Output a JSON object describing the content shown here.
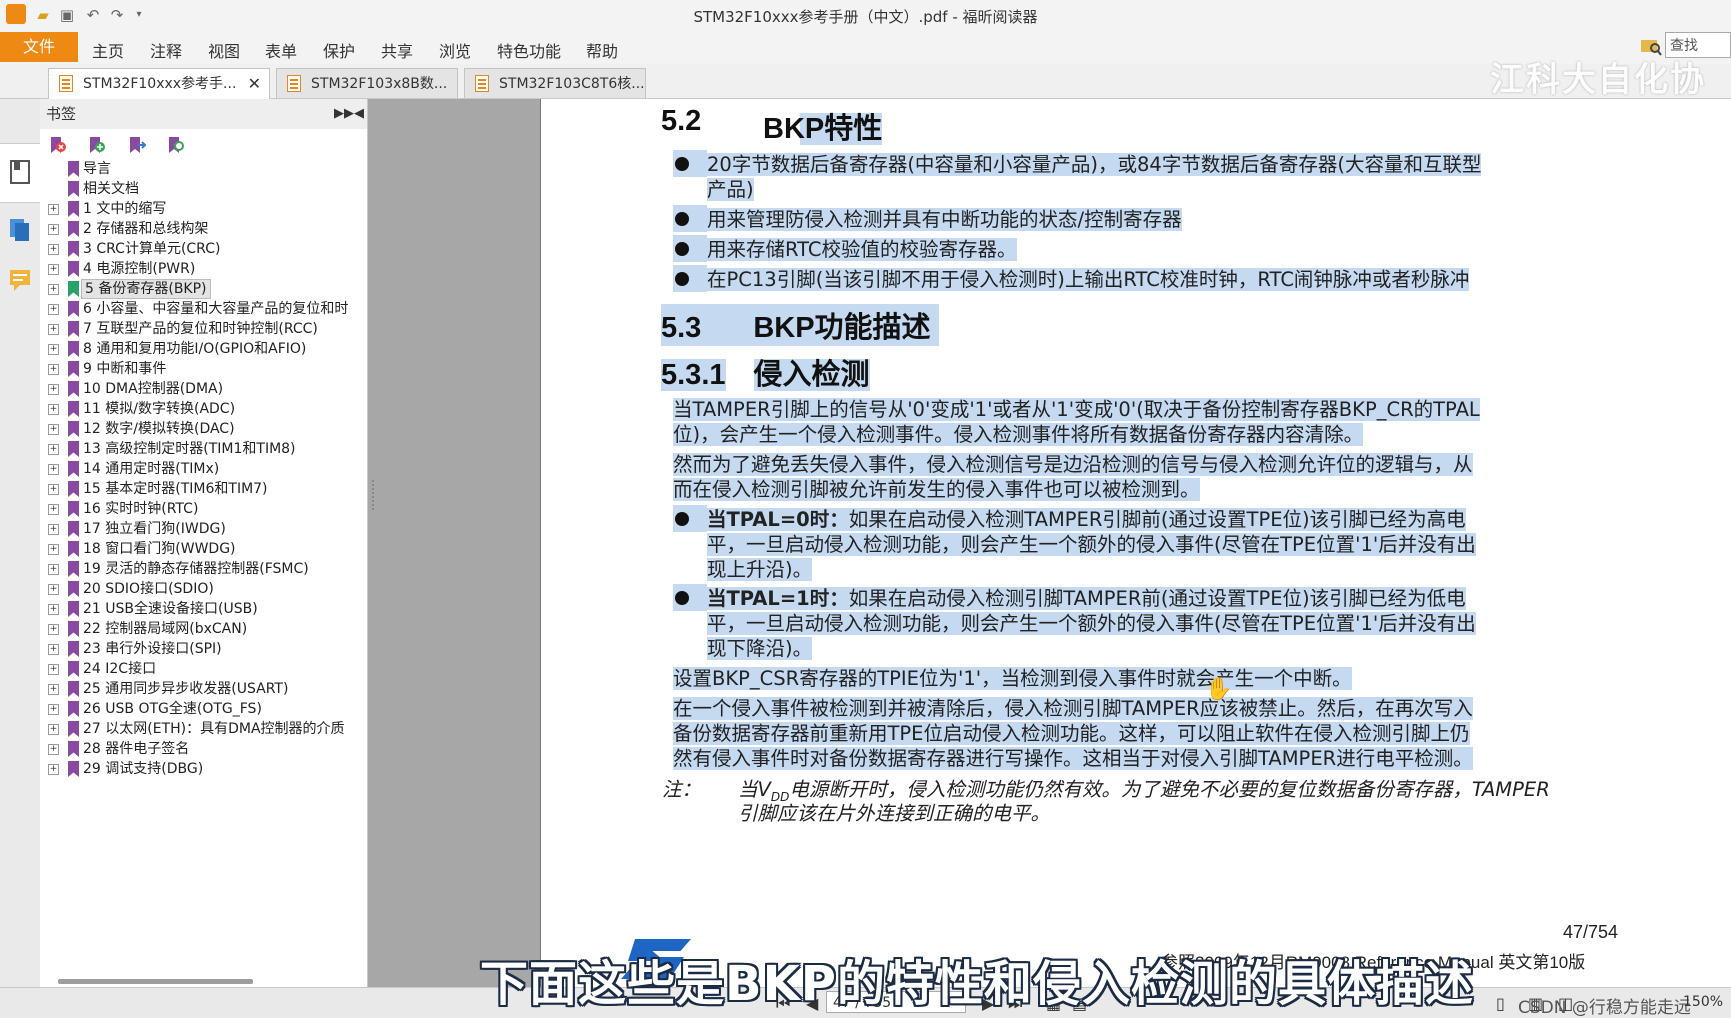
{
  "window": {
    "title": "STM32F10xxx参考手册（中文）.pdf - 福昕阅读器"
  },
  "menu": {
    "file": "文件",
    "items": [
      "主页",
      "注释",
      "视图",
      "表单",
      "保护",
      "共享",
      "浏览",
      "特色功能",
      "帮助"
    ],
    "search_placeholder": "查找"
  },
  "tabs": [
    {
      "label": "STM32F10xxx参考手...",
      "close": "✕"
    },
    {
      "label": "STM32F103x8B数..."
    },
    {
      "label": "STM32F103C8T6核..."
    }
  ],
  "watermark": "江科大自化协",
  "bookmarks": {
    "header": "书签",
    "items": [
      {
        "label": "导言",
        "exp": false
      },
      {
        "label": "相关文档",
        "exp": false
      },
      {
        "label": "1 文中的缩写",
        "exp": true
      },
      {
        "label": "2 存储器和总线构架",
        "exp": true
      },
      {
        "label": "3 CRC计算单元(CRC)",
        "exp": true
      },
      {
        "label": "4 电源控制(PWR)",
        "exp": true
      },
      {
        "label": "5 备份寄存器(BKP)",
        "exp": true,
        "selected": true
      },
      {
        "label": "6 小容量、中容量和大容量产品的复位和时",
        "exp": true
      },
      {
        "label": "7 互联型产品的复位和时钟控制(RCC)",
        "exp": true
      },
      {
        "label": "8 通用和复用功能I/O(GPIO和AFIO)",
        "exp": true
      },
      {
        "label": "9 中断和事件",
        "exp": true
      },
      {
        "label": "10 DMA控制器(DMA)",
        "exp": true
      },
      {
        "label": "11 模拟/数字转换(ADC)",
        "exp": true
      },
      {
        "label": "12 数字/模拟转换(DAC)",
        "exp": true
      },
      {
        "label": "13 高级控制定时器(TIM1和TIM8)",
        "exp": true
      },
      {
        "label": "14 通用定时器(TIMx)",
        "exp": true
      },
      {
        "label": "15 基本定时器(TIM6和TIM7)",
        "exp": true
      },
      {
        "label": "16 实时时钟(RTC)",
        "exp": true
      },
      {
        "label": "17 独立看门狗(IWDG)",
        "exp": true
      },
      {
        "label": "18 窗口看门狗(WWDG)",
        "exp": true
      },
      {
        "label": "19 灵活的静态存储器控制器(FSMC)",
        "exp": true
      },
      {
        "label": "20 SDIO接口(SDIO)",
        "exp": true
      },
      {
        "label": "21 USB全速设备接口(USB)",
        "exp": true
      },
      {
        "label": "22 控制器局域网(bxCAN)",
        "exp": true
      },
      {
        "label": "23 串行外设接口(SPI)",
        "exp": true
      },
      {
        "label": "24 I2C接口",
        "exp": true
      },
      {
        "label": "25 通用同步异步收发器(USART)",
        "exp": true
      },
      {
        "label": "26 USB OTG全速(OTG_FS)",
        "exp": true
      },
      {
        "label": "27 以太网(ETH)：具有DMA控制器的介质",
        "exp": true
      },
      {
        "label": "28 器件电子签名",
        "exp": true
      },
      {
        "label": "29 调试支持(DBG)",
        "exp": true
      }
    ]
  },
  "doc": {
    "s52_num": "5.2",
    "s52_title": "BKP特性",
    "s52_bullets": [
      [
        "20字节数据后备寄存器(中容量和小容量产品)，或84字节数据后备寄存器(大容量和互联型",
        "产品)"
      ],
      [
        "用来管理防侵入检测并具有中断功能的状态/控制寄存器"
      ],
      [
        "用来存储RTC校验值的校验寄存器。"
      ],
      [
        "在PC13引脚(当该引脚不用于侵入检测时)上输出RTC校准时钟，RTC闹钟脉冲或者秒脉冲"
      ]
    ],
    "s53_num": "5.3",
    "s53_title": "BKP功能描述",
    "s531_num": "5.3.1",
    "s531_title": "侵入检测",
    "p1": [
      "当TAMPER引脚上的信号从'0'变成'1'或者从'1'变成'0'(取决于备份控制寄存器BKP_CR的TPAL",
      "位)，会产生一个侵入检测事件。侵入检测事件将所有数据备份寄存器内容清除。"
    ],
    "p2": [
      "然而为了避免丢失侵入事件，侵入检测信号是边沿检测的信号与侵入检测允许位的逻辑与，从",
      "而在侵入检测引脚被允许前发生的侵入事件也可以被检测到。"
    ],
    "b1_bold": "当TPAL=0时：",
    "b1": [
      "如果在启动侵入检测TAMPER引脚前(通过设置TPE位)该引脚已经为高电",
      "平，一旦启动侵入检测功能，则会产生一个额外的侵入事件(尽管在TPE位置'1'后并没有出",
      "现上升沿)。"
    ],
    "b2_bold": "当TPAL=1时：",
    "b2": [
      "如果在启动侵入检测引脚TAMPER前(通过设置TPE位)该引脚已经为低电",
      "平，一旦启动侵入检测功能，则会产生一个额外的侵入事件(尽管在TPE位置'1'后并没有出",
      "现下降沿)。"
    ],
    "p3": "设置BKP_CSR寄存器的TPIE位为'1'，当检测到侵入事件时就会产生一个中断。",
    "p4": [
      "在一个侵入事件被检测到并被清除后，侵入检测引脚TAMPER应该被禁止。然后，在再次写入",
      "备份数据寄存器前重新用TPE位启动侵入检测功能。这样，可以阻止软件在侵入检测引脚上仍",
      "然有侵入事件时对备份数据寄存器进行写操作。这相当于对侵入引脚TAMPER进行电平检测。"
    ],
    "note_label": "注：",
    "note_pre": "当V",
    "note_sub": "DD",
    "note_post": "电源断开时，侵入检测功能仍然有效。为了避免不必要的复位数据备份寄存器，TAMPER",
    "note2": "引脚应该在片外连接到正确的电平。",
    "page_num": "47/754",
    "footer": "参照2009年12月RM0008 Reference Manual  英文第10版"
  },
  "subtitle": "下面这些是BKP的特性和侵入检测的具体描述",
  "status": {
    "page": "47 / 755",
    "csdn": "CSDN @行稳方能走远",
    "zoom": "150%"
  }
}
